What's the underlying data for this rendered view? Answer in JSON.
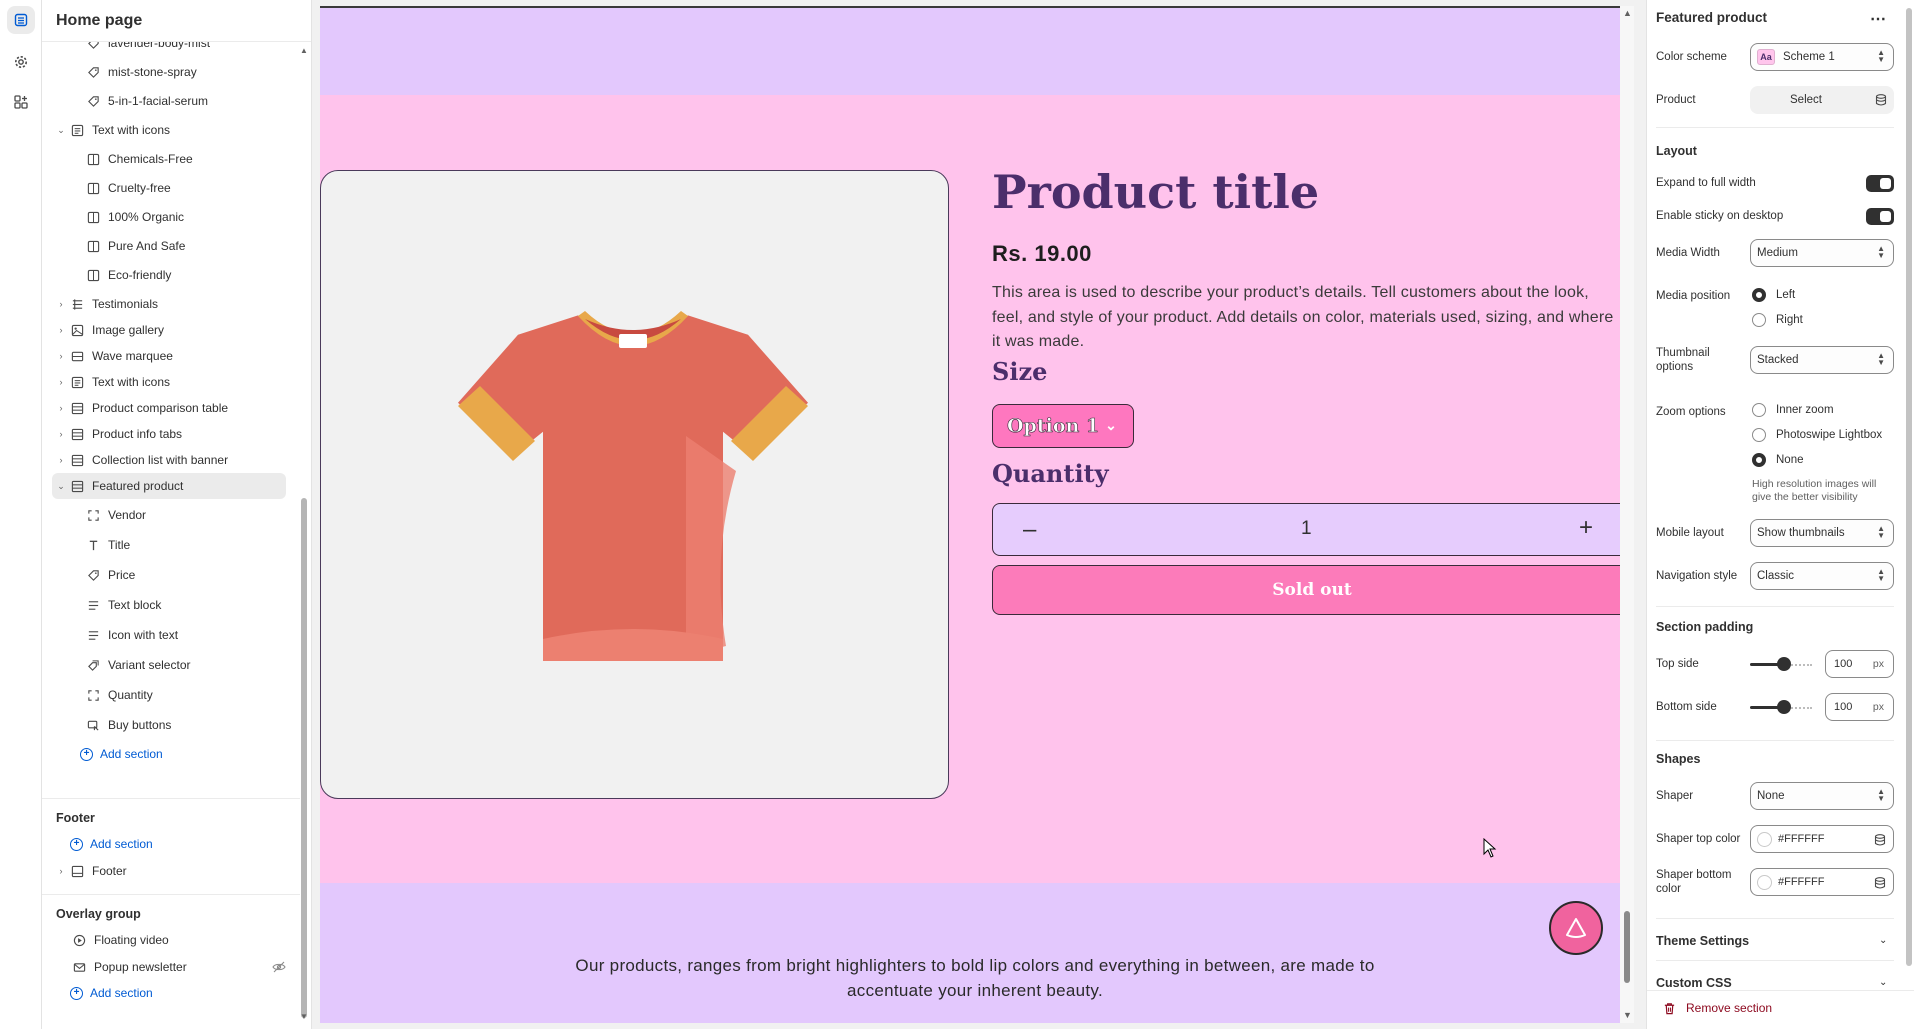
{
  "sidebar": {
    "title": "Home page",
    "items": [
      {
        "label": "lavender-body-mist"
      },
      {
        "label": "mist-stone-spray"
      },
      {
        "label": "5-in-1-facial-serum"
      },
      {
        "label": "Text with icons"
      },
      {
        "label": "Chemicals-Free"
      },
      {
        "label": "Cruelty-free"
      },
      {
        "label": "100% Organic"
      },
      {
        "label": "Pure And Safe"
      },
      {
        "label": "Eco-friendly"
      },
      {
        "label": "Testimonials"
      },
      {
        "label": "Image gallery"
      },
      {
        "label": "Wave marquee"
      },
      {
        "label": "Text with icons"
      },
      {
        "label": "Product comparison table"
      },
      {
        "label": "Product info tabs"
      },
      {
        "label": "Collection list with banner"
      },
      {
        "label": "Featured product"
      },
      {
        "label": "Vendor"
      },
      {
        "label": "Title"
      },
      {
        "label": "Price"
      },
      {
        "label": "Text block"
      },
      {
        "label": "Icon with text"
      },
      {
        "label": "Variant selector"
      },
      {
        "label": "Quantity"
      },
      {
        "label": "Buy buttons"
      }
    ],
    "add_section": "Add section",
    "footer_group": "Footer",
    "footer_item": "Footer",
    "overlay_group": "Overlay group",
    "overlay_items": [
      {
        "label": "Floating video"
      },
      {
        "label": "Popup newsletter"
      }
    ]
  },
  "preview": {
    "product_title": "Product title",
    "price": "Rs. 19.00",
    "description": "This area is used to describe your product’s details. Tell customers about the look, feel, and style of your product. Add details on color, materials used, sizing, and where it was made.",
    "size_label": "Size",
    "size_option": "Option 1",
    "quantity_label": "Quantity",
    "quantity_value": "1",
    "minus": "–",
    "plus": "+",
    "sold_out": "Sold out",
    "footer_text": "Our products, ranges from bright highlighters to bold lip colors and everything in between, are made to accentuate your inherent beauty."
  },
  "settings": {
    "header": "Featured product",
    "color_scheme_label": "Color scheme",
    "color_scheme_value": "Scheme 1",
    "color_scheme_swatch": "Aa",
    "product_label": "Product",
    "product_button": "Select",
    "layout_heading": "Layout",
    "expand_label": "Expand to full width",
    "expand_on": true,
    "sticky_label": "Enable sticky on desktop",
    "sticky_on": true,
    "media_width_label": "Media Width",
    "media_width_value": "Medium",
    "media_position_label": "Media position",
    "media_position_options": [
      "Left",
      "Right"
    ],
    "media_position_selected": "Left",
    "thumbnail_label": "Thumbnail options",
    "thumbnail_value": "Stacked",
    "zoom_label": "Zoom options",
    "zoom_options": [
      "Inner zoom",
      "Photoswipe Lightbox",
      "None"
    ],
    "zoom_selected": "None",
    "zoom_help": "High resolution images will give the better visibility",
    "mobile_layout_label": "Mobile layout",
    "mobile_layout_value": "Show thumbnails",
    "nav_style_label": "Navigation style",
    "nav_style_value": "Classic",
    "section_padding_heading": "Section padding",
    "top_side_label": "Top side",
    "top_side_value": "100",
    "bottom_side_label": "Bottom side",
    "bottom_side_value": "100",
    "unit": "px",
    "shapes_heading": "Shapes",
    "shaper_label": "Shaper",
    "shaper_value": "None",
    "shaper_top_label": "Shaper top color",
    "shaper_top_value": "#FFFFFF",
    "shaper_bottom_label": "Shaper bottom color",
    "shaper_bottom_value": "#FFFFFF",
    "theme_settings": "Theme Settings",
    "custom_css": "Custom CSS",
    "remove_section": "Remove section"
  }
}
